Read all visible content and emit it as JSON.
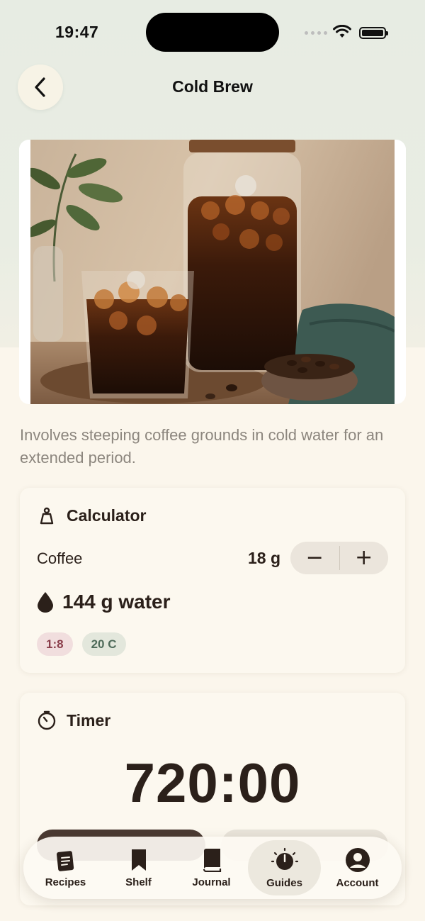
{
  "status_bar": {
    "time": "19:47"
  },
  "nav": {
    "title": "Cold Brew"
  },
  "description": "Involves steeping coffee grounds in cold water for an extended period.",
  "calculator": {
    "title": "Calculator",
    "coffee_label": "Coffee",
    "coffee_amount": "18 g",
    "decrement_symbol": "−",
    "increment_symbol": "+",
    "water_amount": "144 g water",
    "ratio_chip": "1:8",
    "temp_chip": "20 C"
  },
  "timer": {
    "title": "Timer",
    "display": "720:00"
  },
  "tab_bar": {
    "tabs": [
      {
        "label": "Recipes",
        "icon": "recipes-icon",
        "active": false
      },
      {
        "label": "Shelf",
        "icon": "bookmark-icon",
        "active": false
      },
      {
        "label": "Journal",
        "icon": "book-icon",
        "active": false
      },
      {
        "label": "Guides",
        "icon": "timer-dial-icon",
        "active": true
      },
      {
        "label": "Account",
        "icon": "account-icon",
        "active": false
      }
    ]
  },
  "colors": {
    "background": "#fbf6ec",
    "accent_dark": "#2b201a",
    "ratio_chip_bg": "#f1dede",
    "temp_chip_bg": "#e3e7dc"
  }
}
